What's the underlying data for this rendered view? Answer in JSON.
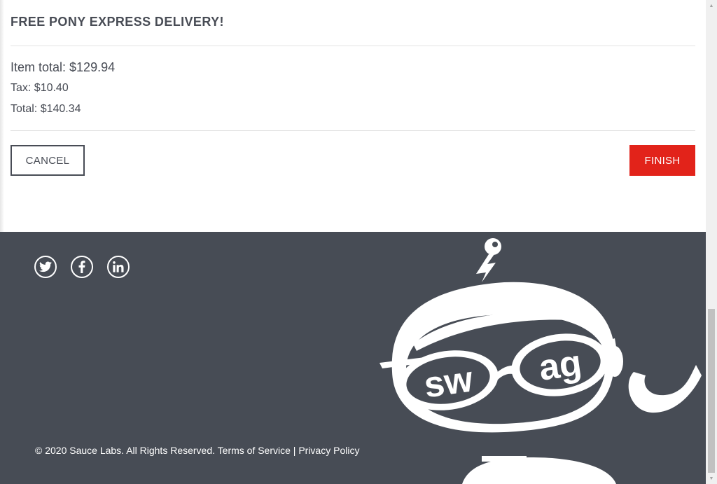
{
  "shipping_info": "FREE PONY EXPRESS DELIVERY!",
  "summary": {
    "item_total": "Item total: $129.94",
    "tax": "Tax: $10.40",
    "total": "Total: $140.34"
  },
  "actions": {
    "cancel_label": "CANCEL",
    "finish_label": "FINISH"
  },
  "footer": {
    "social": [
      "twitter-icon",
      "facebook-icon",
      "linkedin-icon"
    ],
    "copy_text": "© 2020 Sauce Labs. All Rights Reserved. Terms of Service | Privacy Policy",
    "robot_text": [
      "sw",
      "ag"
    ]
  },
  "colors": {
    "accent": "#e2231a",
    "footer_bg": "#474c55",
    "text": "#484c55"
  },
  "scrollbar": {
    "position": 0.94
  }
}
